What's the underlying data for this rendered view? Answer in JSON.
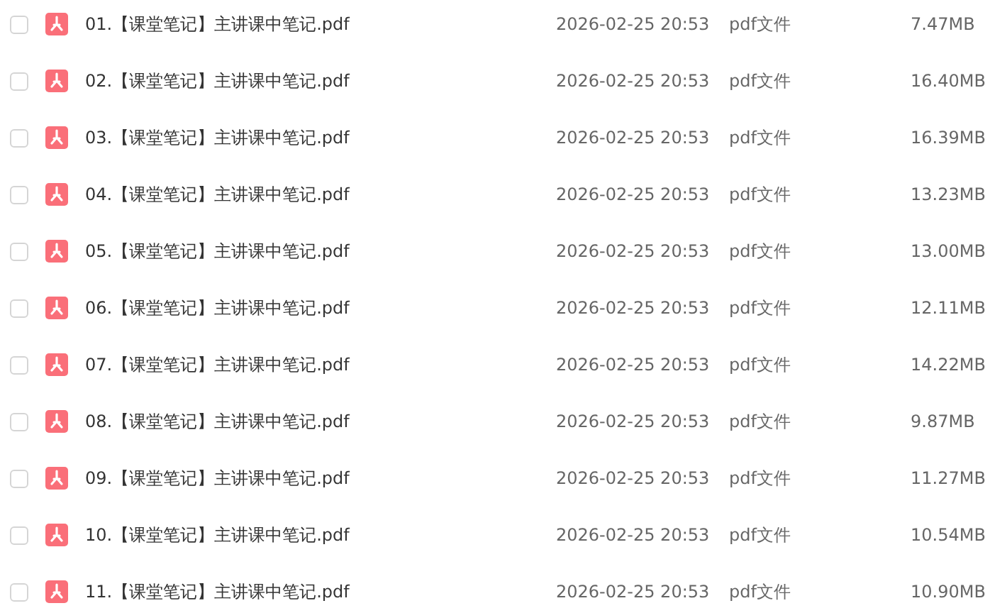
{
  "files": [
    {
      "name": "01.【课堂笔记】主讲课中笔记.pdf",
      "modified": "2026-02-25 20:53",
      "type": "pdf文件",
      "size": "7.47MB",
      "checked": false
    },
    {
      "name": "02.【课堂笔记】主讲课中笔记.pdf",
      "modified": "2026-02-25 20:53",
      "type": "pdf文件",
      "size": "16.40MB",
      "checked": false
    },
    {
      "name": "03.【课堂笔记】主讲课中笔记.pdf",
      "modified": "2026-02-25 20:53",
      "type": "pdf文件",
      "size": "16.39MB",
      "checked": false
    },
    {
      "name": "04.【课堂笔记】主讲课中笔记.pdf",
      "modified": "2026-02-25 20:53",
      "type": "pdf文件",
      "size": "13.23MB",
      "checked": false
    },
    {
      "name": "05.【课堂笔记】主讲课中笔记.pdf",
      "modified": "2026-02-25 20:53",
      "type": "pdf文件",
      "size": "13.00MB",
      "checked": false
    },
    {
      "name": "06.【课堂笔记】主讲课中笔记.pdf",
      "modified": "2026-02-25 20:53",
      "type": "pdf文件",
      "size": "12.11MB",
      "checked": false
    },
    {
      "name": "07.【课堂笔记】主讲课中笔记.pdf",
      "modified": "2026-02-25 20:53",
      "type": "pdf文件",
      "size": "14.22MB",
      "checked": false
    },
    {
      "name": "08.【课堂笔记】主讲课中笔记.pdf",
      "modified": "2026-02-25 20:53",
      "type": "pdf文件",
      "size": "9.87MB",
      "checked": false
    },
    {
      "name": "09.【课堂笔记】主讲课中笔记.pdf",
      "modified": "2026-02-25 20:53",
      "type": "pdf文件",
      "size": "11.27MB",
      "checked": false
    },
    {
      "name": "10.【课堂笔记】主讲课中笔记.pdf",
      "modified": "2026-02-25 20:53",
      "type": "pdf文件",
      "size": "10.54MB",
      "checked": false
    },
    {
      "name": "11.【课堂笔记】主讲课中笔记.pdf",
      "modified": "2026-02-25 20:53",
      "type": "pdf文件",
      "size": "10.90MB",
      "checked": false
    }
  ]
}
